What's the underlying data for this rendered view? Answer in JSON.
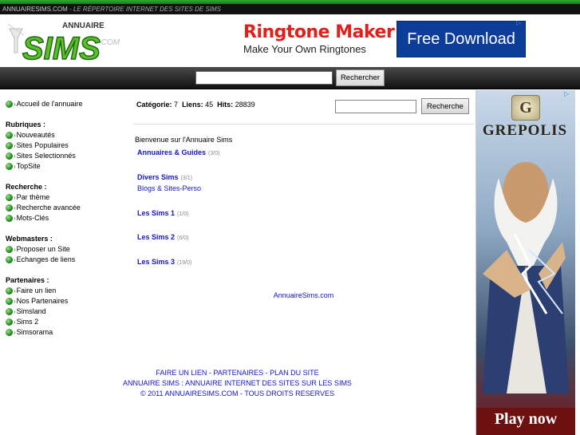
{
  "tagline": {
    "site": "ANNUAIRESIMS.COM",
    "site_bold": "SIMS",
    "slogan": "- LE RÉPERTOIRE INTERNET DES SITES DE SIMS"
  },
  "logo": {
    "small": "ANNUAIRE",
    "big": "SIMS",
    "suffix": ".COM"
  },
  "ad_top": {
    "title": "Ringtone Maker",
    "subtitle": "Make Your Own Ringtones",
    "button": "Free Download"
  },
  "top_search": {
    "value": "",
    "button": "Rechercher"
  },
  "left_menu": {
    "home": "Accueil de l'annuaire",
    "rubriques": {
      "heading": "Rubriques :",
      "items": [
        "Nouveautés",
        "Sites Populaires",
        "Sites Selectionnés",
        "TopSite"
      ]
    },
    "recherche": {
      "heading": "Recherche :",
      "items": [
        "Par thème",
        "Recherche avancée",
        "Mots-Clés"
      ]
    },
    "webmasters": {
      "heading": "Webmasters :",
      "items": [
        "Proposer un Site",
        "Echanges de liens"
      ]
    },
    "partenaires": {
      "heading": "Partenaires :",
      "items": [
        "Faire un lien",
        "Nos Partenaires",
        "Simsland",
        "Sims 2",
        "Simsorama"
      ]
    }
  },
  "stats": {
    "categorie_label": "Catégorie:",
    "categorie_value": "7",
    "liens_label": "Liens:",
    "liens_value": "45",
    "hits_label": "Hits:",
    "hits_value": "28839"
  },
  "inner_search": {
    "value": "",
    "button": "Recherche"
  },
  "welcome": "Bienvenue sur l'Annuaire Sims",
  "categories": [
    {
      "name": "Annuaires & Guides",
      "count": "(3/0)"
    },
    {
      "name": "Divers Sims",
      "count": "(3/1)",
      "sub": "Blogs & Sites-Perso"
    },
    {
      "name": "Les Sims 1",
      "count": "(1/0)"
    },
    {
      "name": "Les Sims 2",
      "count": "(6/0)"
    },
    {
      "name": "Les Sims 3",
      "count": "(19/0)"
    }
  ],
  "site_footer": "AnnuaireSims.com",
  "footer": {
    "line1": "FAIRE UN LIEN - PARTENAIRES - PLAN DU SITE",
    "line2": "ANNUAIRE SIMS : ANNUAIRE INTERNET DES SITES SUR LES SIMS",
    "line3": "© 2011 ANNUAIRESIMS.COM - TOUS DROITS RESERVES"
  },
  "sky_ad": {
    "emblem": "G",
    "brand": "GREPOLIS",
    "cta": "Play now"
  },
  "colors": {
    "accent_green": "#1f8a1f",
    "link_blue": "#1414c8",
    "bar_dark": "#111111"
  }
}
